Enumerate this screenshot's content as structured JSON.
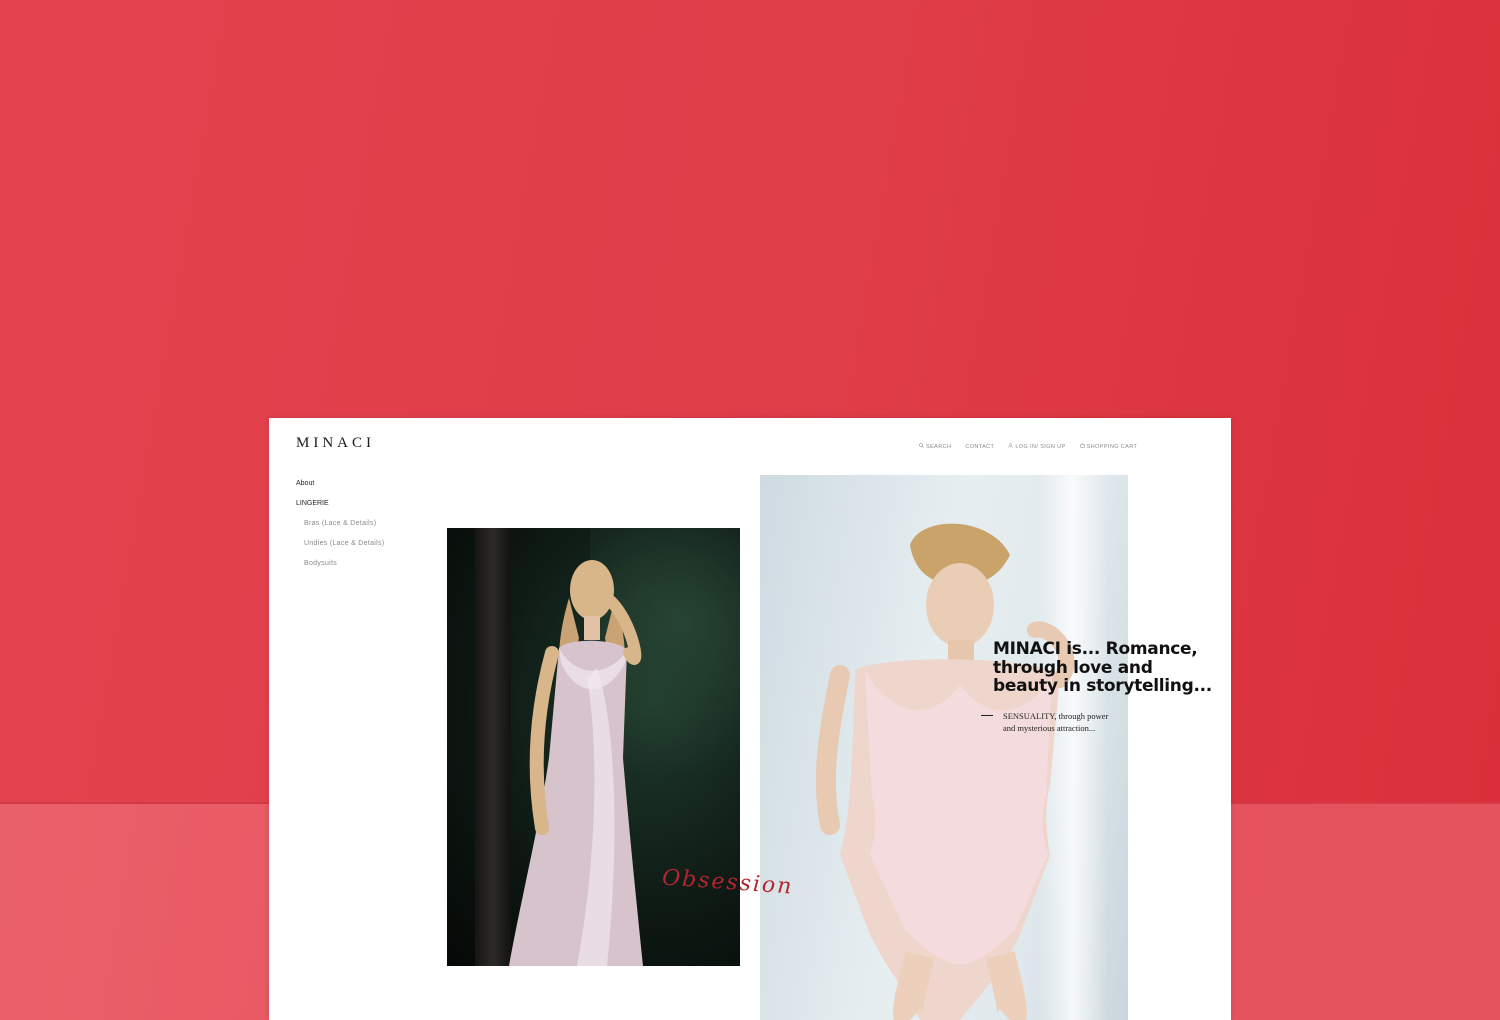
{
  "brand": {
    "logo": "MINACI"
  },
  "topnav": {
    "items": [
      {
        "label": "SEARCH",
        "icon": "search-icon"
      },
      {
        "label": "CONTACT",
        "icon": ""
      },
      {
        "label": "LOG IN/ SIGN UP",
        "icon": "user-icon"
      },
      {
        "label": "SHOPPING CART",
        "icon": "cart-icon"
      }
    ]
  },
  "sidebar": {
    "items": [
      {
        "label": "About"
      },
      {
        "label": "LINGERIE"
      },
      {
        "label": "Bras (Lace & Details)"
      },
      {
        "label": "Undies (Lace & Details)"
      },
      {
        "label": "Bodysuits"
      }
    ]
  },
  "hero": {
    "script_word": "Obsession",
    "tagline_lines": [
      "MINACI is... Romance,",
      "through  love  and",
      "beauty in storytelling..."
    ],
    "subtag_lines": [
      "SENSUALITY, through power",
      "and mysterious attraction..."
    ]
  },
  "colors": {
    "backdrop": "#df3d48",
    "accent_script": "#b3262e"
  }
}
